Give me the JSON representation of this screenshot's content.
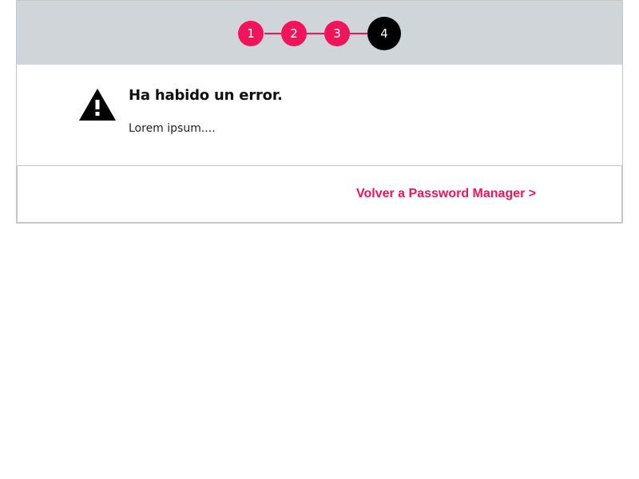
{
  "stepper": {
    "steps": [
      {
        "label": "1",
        "state": "done"
      },
      {
        "label": "2",
        "state": "done"
      },
      {
        "label": "3",
        "state": "done"
      },
      {
        "label": "4",
        "state": "current"
      }
    ],
    "current_step": 4,
    "colors": {
      "done": "#f0145a",
      "current": "#000000",
      "bar_background": "#cfd5d8"
    }
  },
  "message": {
    "icon": "warning-triangle-icon",
    "title": "Ha habido un error.",
    "body": "Lorem ipsum...."
  },
  "footer": {
    "back_link_label": "Volver a Password Manager >",
    "link_color": "#f0145a"
  }
}
